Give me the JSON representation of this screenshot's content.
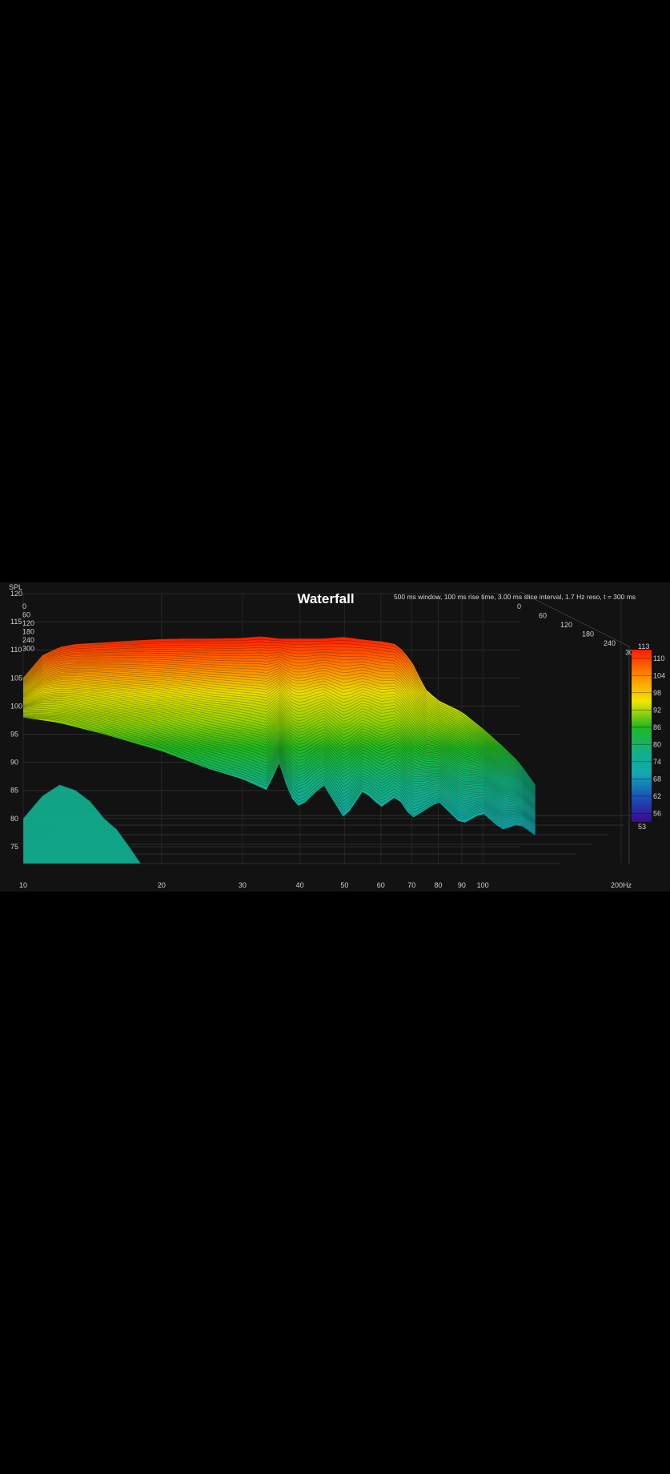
{
  "chart_data": {
    "type": "waterfall",
    "title": "Waterfall",
    "subtitle": "500 ms window, 100 ms rise time, 3.00 ms slice interval, 1.7 Hz reso, t = 300 ms",
    "ylabel": "SPL",
    "y_ticks": [
      "120",
      "115",
      "110",
      "105",
      "100",
      "95",
      "90",
      "85",
      "80",
      "75"
    ],
    "ylim": [
      72,
      120
    ],
    "x_ticks": [
      "10",
      "20",
      "30",
      "40",
      "50",
      "60",
      "70",
      "80",
      "90",
      "100",
      "200Hz"
    ],
    "x_tick_values": [
      10,
      20,
      30,
      40,
      50,
      60,
      70,
      80,
      90,
      100,
      200
    ],
    "xlim": [
      10,
      200
    ],
    "x_scale": "log",
    "time_ticks_left": [
      "0",
      "60",
      "120",
      "180",
      "240",
      "300"
    ],
    "time_ticks_right": [
      "0",
      "60",
      "120",
      "180",
      "240",
      "300"
    ],
    "time_range_ms": [
      0,
      300
    ],
    "colorbar": {
      "min_label": "53",
      "max_label": "113",
      "ticks": [
        "110",
        "104",
        "98",
        "92",
        "86",
        "80",
        "74",
        "68",
        "62",
        "56"
      ],
      "colors": [
        "#ff1a00",
        "#ff8a00",
        "#f2e600",
        "#9fd600",
        "#1fb81f",
        "#12b08a",
        "#13a8b0",
        "#1a6bb8",
        "#1d2fb0",
        "#3a0a8a"
      ]
    },
    "series": [
      {
        "x": [
          10,
          11,
          12,
          13,
          15,
          17,
          20,
          23,
          26,
          30,
          33,
          36,
          40,
          45,
          50,
          55,
          60,
          65,
          70,
          75,
          80,
          90,
          100,
          110,
          120,
          130
        ],
        "values": [
          105,
          109,
          110.5,
          111,
          111.3,
          111.6,
          111.9,
          112,
          112,
          112.1,
          112.4,
          112,
          112,
          112,
          112.3,
          111.8,
          111.5,
          111,
          108,
          103,
          101,
          99,
          96,
          93,
          90,
          86
        ]
      },
      {
        "x": [
          10,
          12,
          15,
          20,
          25,
          30,
          34,
          36,
          38,
          40,
          45,
          50,
          55,
          60,
          65,
          70,
          80,
          90,
          100,
          110,
          120,
          130
        ],
        "values": [
          98,
          97,
          95,
          92,
          89,
          87,
          85,
          90,
          84,
          82,
          86,
          80,
          85,
          82,
          84,
          80,
          83,
          79,
          81,
          78,
          79,
          77
        ]
      },
      {
        "x": [
          10,
          11,
          12,
          13,
          14,
          15,
          16,
          17,
          18
        ],
        "values": [
          80,
          84,
          86,
          85,
          83,
          80,
          78,
          75,
          72
        ]
      }
    ]
  }
}
